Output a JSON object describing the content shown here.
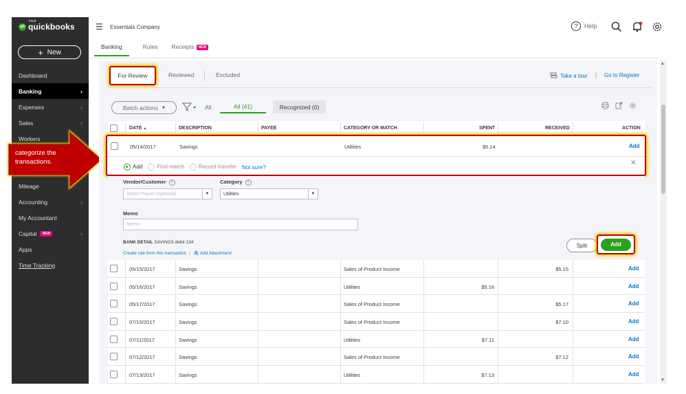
{
  "brand": {
    "intuit": "intuit",
    "name": "quickbooks",
    "mark": "qb"
  },
  "sidebar": {
    "new_label": "New",
    "items": [
      {
        "label": "Dashboard",
        "chev": false
      },
      {
        "label": "Banking",
        "chev": true,
        "active": true
      },
      {
        "label": "Expenses",
        "chev": true
      },
      {
        "label": "Sales",
        "chev": true
      },
      {
        "label": "Workers",
        "chev": false
      },
      {
        "label": "",
        "chev": false
      },
      {
        "label": "",
        "chev": false
      },
      {
        "label": "Mileage",
        "chev": false
      },
      {
        "label": "Accounting",
        "chev": true
      },
      {
        "label": "My Accountant",
        "chev": false
      },
      {
        "label": "Capital",
        "chev": true,
        "badge": "NEW"
      },
      {
        "label": "Apps",
        "chev": false
      },
      {
        "label": "Time Tracking",
        "chev": false,
        "link": true
      }
    ]
  },
  "callout": {
    "text": "categorize the transactions."
  },
  "topbar": {
    "company": "Essentials Company",
    "help": "Help"
  },
  "subtabs": {
    "banking": "Banking",
    "rules": "Rules",
    "receipts": "Receipts",
    "new_badge": "NEW"
  },
  "review_tabs": {
    "for_review": "For Review",
    "reviewed": "Reviewed",
    "excluded": "Excluded"
  },
  "links": {
    "tour": "Take a tour",
    "register": "Go to Register",
    "sep": "|"
  },
  "toolbar": {
    "batch": "Batch actions",
    "filter_all": "All",
    "all_tab": "All (41)",
    "recognized_tab": "Recognized (0)"
  },
  "table": {
    "headers": {
      "date": "DATE",
      "sort": "▲",
      "description": "DESCRIPTION",
      "payee": "PAYEE",
      "category": "CATEGORY OR MATCH",
      "spent": "SPENT",
      "received": "RECEIVED",
      "action": "ACTION"
    },
    "expanded": {
      "date": "05/14/2017",
      "description": "Savings",
      "payee": "",
      "category": "Utilities",
      "spent": "$5.14",
      "received": "",
      "action": "Add"
    },
    "rows": [
      {
        "date": "05/15/2017",
        "description": "Savings",
        "payee": "",
        "category": "Sales of Product Income",
        "spent": "",
        "received": "$5.15",
        "action": "Add"
      },
      {
        "date": "05/16/2017",
        "description": "Savings",
        "payee": "",
        "category": "Utilities",
        "spent": "$5.16",
        "received": "",
        "action": "Add"
      },
      {
        "date": "05/17/2017",
        "description": "Savings",
        "payee": "",
        "category": "Sales of Product Income",
        "spent": "",
        "received": "$5.17",
        "action": "Add"
      },
      {
        "date": "07/10/2017",
        "description": "Savings",
        "payee": "",
        "category": "Sales of Product Income",
        "spent": "",
        "received": "$7.10",
        "action": "Add"
      },
      {
        "date": "07/11/2017",
        "description": "Savings",
        "payee": "",
        "category": "Utilities",
        "spent": "$7.11",
        "received": "",
        "action": "Add"
      },
      {
        "date": "07/12/2017",
        "description": "Savings",
        "payee": "",
        "category": "Sales of Product Income",
        "spent": "",
        "received": "$7.12",
        "action": "Add"
      },
      {
        "date": "07/13/2017",
        "description": "Savings",
        "payee": "",
        "category": "Utilities",
        "spent": "$7.13",
        "received": "",
        "action": "Add"
      }
    ]
  },
  "match_options": {
    "add": "Add",
    "find": "Find match",
    "transfer": "Record transfer",
    "not_sure": "Not sure?"
  },
  "form": {
    "vendor_label": "Vendor/Customer",
    "vendor_placeholder": "Select Payee (optional)",
    "category_label": "Category",
    "category_value": "Utilities",
    "memo_label": "Memo",
    "memo_placeholder": "Memo",
    "bank_detail_label": "BANK DETAIL",
    "bank_detail_value": "SAVINGS debit 134",
    "create_rule": "Create rule from this transaction",
    "add_attachment": "Add Attachment",
    "split": "Split",
    "add": "Add"
  },
  "colors": {
    "accent": "#2ca01c",
    "link": "#0077c5",
    "sidebar": "#2d2d2d",
    "highlight": "#b00000",
    "glow": "#f5c400"
  }
}
